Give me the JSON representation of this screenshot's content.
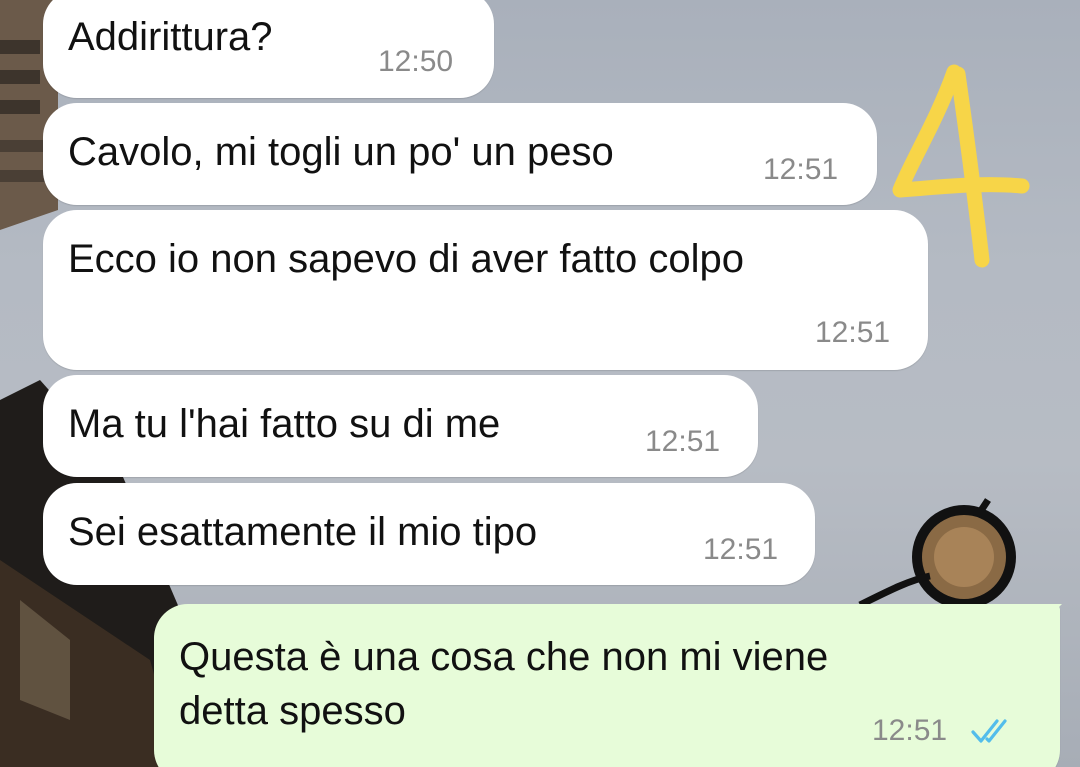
{
  "conversation": {
    "messages": [
      {
        "direction": "incoming",
        "text": "Addirittura?",
        "time": "12:50"
      },
      {
        "direction": "incoming",
        "text": "Cavolo, mi togli un po' un peso",
        "time": "12:51"
      },
      {
        "direction": "incoming",
        "text": "Ecco io non sapevo di aver fatto colpo",
        "time": "12:51"
      },
      {
        "direction": "incoming",
        "text": "Ma tu l'hai fatto su di me",
        "time": "12:51"
      },
      {
        "direction": "incoming",
        "text": "Sei esattamente il mio tipo",
        "time": "12:51"
      },
      {
        "direction": "outgoing",
        "text_line1": "Questa è una cosa che non mi viene",
        "text_line2": "detta spesso",
        "time": "12:51",
        "status": "read",
        "status_icon": "double-check-icon"
      }
    ]
  },
  "annotation": {
    "text": "4",
    "color": "#f7d548"
  },
  "colors": {
    "incoming_bubble": "#ffffff",
    "outgoing_bubble": "#e7fcd9",
    "read_ticks": "#53bdeb"
  }
}
